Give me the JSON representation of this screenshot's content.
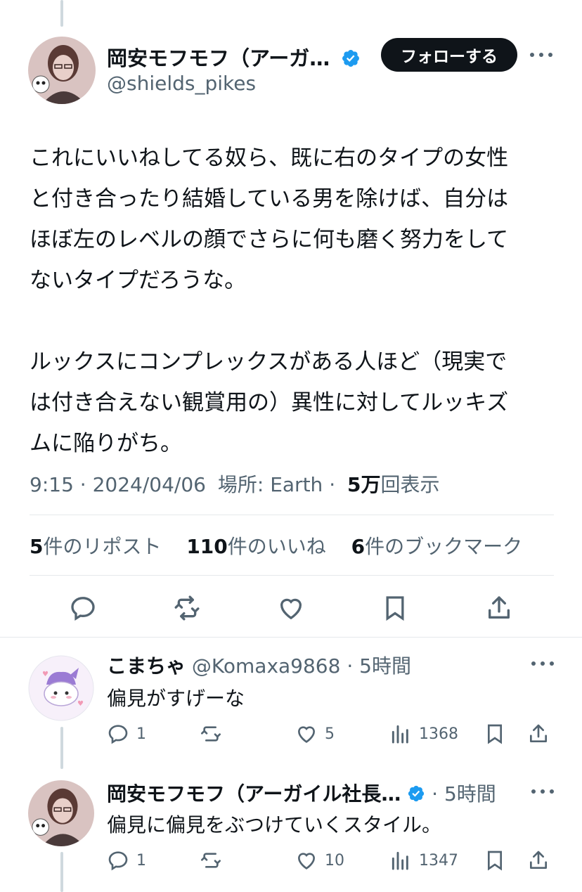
{
  "main_tweet": {
    "display_name": "岡安モフモフ（アーガ…",
    "handle": "@shields_pikes",
    "follow_label": "フォローする",
    "text": "これにいいねしてる奴ら、既に右のタイプの女性\nと付き合ったり結婚している男を除けば、自分は\nほぼ左のレベルの顔でさらに何も磨く努力をして\nないタイプだろうな。\n\nルックスにコンプレックスがある人ほど（現実で\nは付き合えない観賞用の）異性に対してルッキズ\nムに陥りがち。",
    "time": "9:15 · 2024/04/06",
    "location": "場所: Earth ·",
    "views_count": "5万",
    "views_label": "回表示",
    "reposts_count": "5",
    "reposts_label": "件のリポスト",
    "likes_count": "110",
    "likes_label": "件のいいね",
    "bookmarks_count": "6",
    "bookmarks_label": "件のブックマーク"
  },
  "replies": [
    {
      "display_name": "こまちゃ",
      "handle": "@Komaxa9868",
      "time": "· 5時間",
      "text": "偏見がすげーな",
      "reply_count": "1",
      "like_count": "5",
      "view_count": "1368"
    },
    {
      "display_name": "岡安モフモフ（アーガイル社長…",
      "handle": "",
      "time": "· 5時間",
      "text": "偏見に偏見をぶつけていくスタイル。",
      "reply_count": "1",
      "like_count": "10",
      "view_count": "1347"
    }
  ],
  "colors": {
    "text": "#0f1419",
    "secondary": "#536471",
    "verified": "#1d9bf0",
    "divider": "#e5e9eb"
  }
}
